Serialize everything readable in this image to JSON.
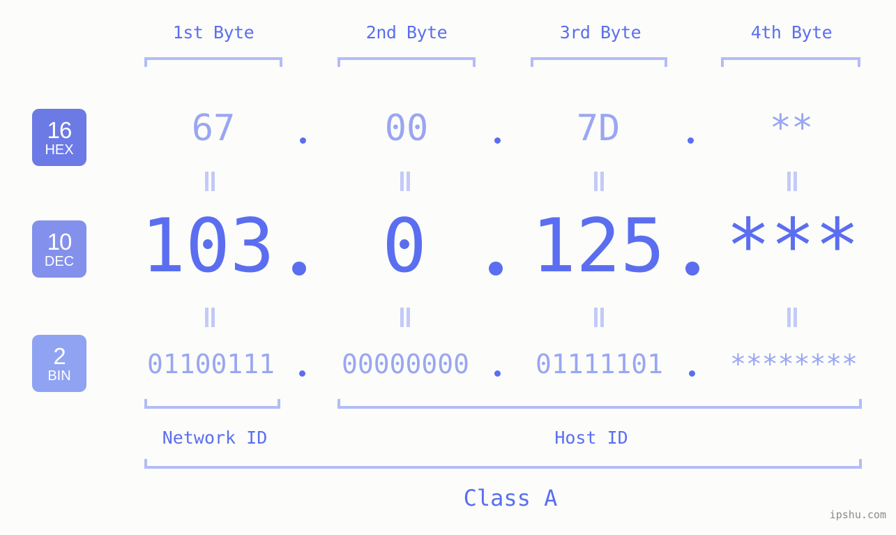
{
  "meta": {
    "background_color": "#fcfdfa",
    "accent_strong": "#5b6ef0",
    "accent_light": "#9aa6f2",
    "bracket_color": "#b3bcf8",
    "watermark": "ipshu.com"
  },
  "header": {
    "byte_labels": [
      "1st Byte",
      "2nd Byte",
      "3rd Byte",
      "4th Byte"
    ]
  },
  "bases": [
    {
      "number": "16",
      "name": "HEX",
      "color": "#6c7ae5"
    },
    {
      "number": "10",
      "name": "DEC",
      "color": "#8391ec"
    },
    {
      "number": "2",
      "name": "BIN",
      "color": "#8fa3f2"
    }
  ],
  "rows": {
    "hex": {
      "base_number": "16",
      "base_name": "HEX",
      "values": [
        "67",
        "00",
        "7D",
        "**"
      ],
      "separator": "."
    },
    "dec": {
      "base_number": "10",
      "base_name": "DEC",
      "values": [
        "103",
        "0",
        "125",
        "***"
      ],
      "separator": "."
    },
    "bin": {
      "base_number": "2",
      "base_name": "BIN",
      "values": [
        "01100111",
        "00000000",
        "01111101",
        "********"
      ],
      "separator": "."
    }
  },
  "equals_marks": {
    "glyph": "||",
    "count_per_gap": 4,
    "gaps": 2
  },
  "footer": {
    "network_id_label": "Network ID",
    "host_id_label": "Host ID",
    "class_label": "Class A"
  }
}
